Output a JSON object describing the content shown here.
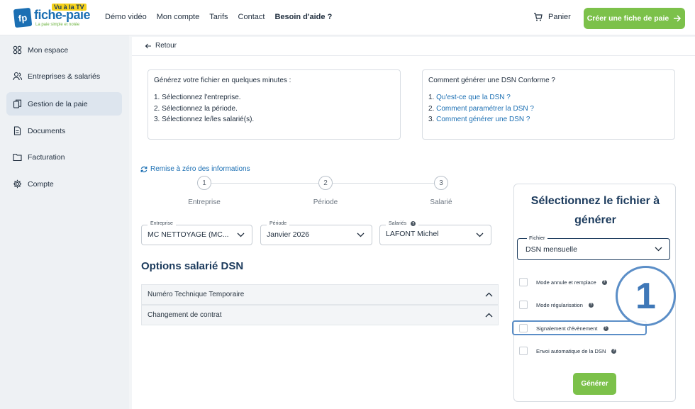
{
  "header": {
    "logo": {
      "short": "fp",
      "name": "fiche-paie",
      "tv": "Vu à la TV",
      "tagline": "La paie simple et notée"
    },
    "nav": [
      "Démo vidéo",
      "Mon compte",
      "Tarifs",
      "Contact",
      "Besoin d'aide ?"
    ],
    "cart_label": "Panier",
    "cta_label": "Créer une fiche de paie",
    "cta_icon": "arrow-right-icon"
  },
  "sidebar": {
    "items": [
      {
        "label": "Mon espace",
        "icon": "grid-icon"
      },
      {
        "label": "Entreprises & salariés",
        "icon": "users-icon"
      },
      {
        "label": "Gestion de la paie",
        "icon": "copy-icon",
        "active": true
      },
      {
        "label": "Documents",
        "icon": "document-icon"
      },
      {
        "label": "Facturation",
        "icon": "folder-icon"
      },
      {
        "label": "Compte",
        "icon": "gear-icon"
      }
    ]
  },
  "main": {
    "back_label": "Retour",
    "info_left": {
      "title": "Générez votre fichier en quelques minutes :",
      "steps": [
        "1. Sélectionnez l'entreprise.",
        "2. Sélectionnez la période.",
        "3. Sélectionnez le/les salarié(s)."
      ]
    },
    "info_right": {
      "title": "Comment générer une DSN Conforme ?",
      "links": [
        {
          "num": "1.",
          "text": "Qu'est-ce que la DSN ?"
        },
        {
          "num": "2.",
          "text": "Comment paramétrer la DSN ?"
        },
        {
          "num": "3.",
          "text": "Comment générer une DSN ?"
        }
      ]
    },
    "reset_label": "Remise à zéro des informations",
    "stepper": [
      {
        "num": "1",
        "label": "Entreprise"
      },
      {
        "num": "2",
        "label": "Période"
      },
      {
        "num": "3",
        "label": "Salarié"
      }
    ],
    "selects": {
      "entreprise": {
        "label": "Entreprise",
        "value": "MC NETTOYAGE (MC..."
      },
      "periode": {
        "label": "Période",
        "value": "Janvier 2026"
      },
      "salaries": {
        "label": "Salariés",
        "value": "LAFONT Michel"
      }
    },
    "options_title": "Options salarié DSN",
    "accordions": [
      "Numéro Technique Temporaire",
      "Changement de contrat"
    ]
  },
  "panel": {
    "title": "Sélectionnez le fichier à générer",
    "file_label": "Fichier",
    "file_value": "DSN mensuelle",
    "checkboxes": [
      "Mode annule et remplace",
      "Mode régularisation",
      "Signalement d'évènement",
      "Envoi automatique de la DSN"
    ],
    "help_glyph": "?",
    "callout_number": "1",
    "generate_label": "Générer"
  },
  "colors": {
    "accent_green": "#7cc14a",
    "brand_blue": "#1b6fb3",
    "callout_blue": "#5b8ec7",
    "navy": "#1b3a5c"
  }
}
